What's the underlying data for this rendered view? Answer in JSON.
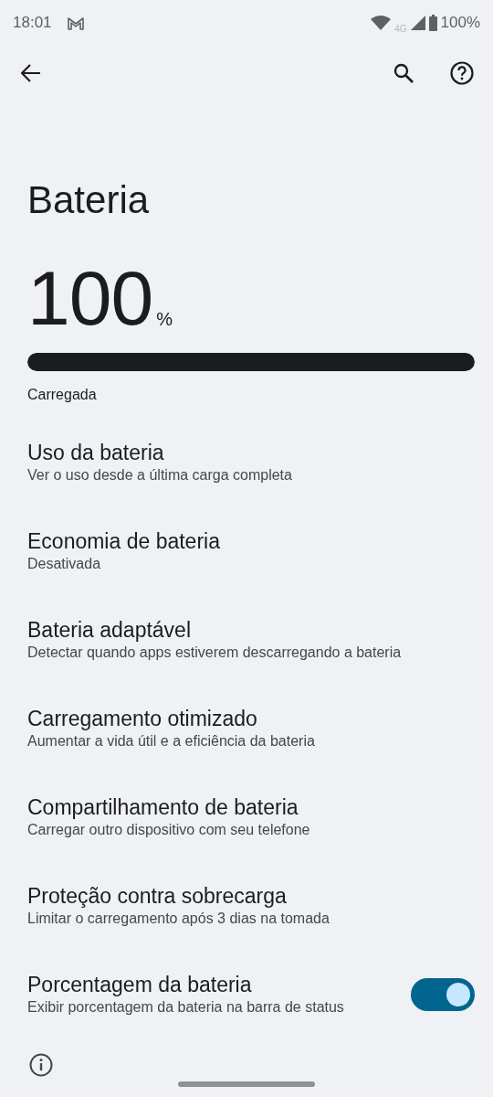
{
  "status_bar": {
    "time": "18:01",
    "network": "4G",
    "battery_text": "100%"
  },
  "title": "Bateria",
  "battery": {
    "value": "100",
    "unit": "%",
    "level": 1.0,
    "state": "Carregada"
  },
  "items": [
    {
      "kind": "link",
      "title": "Uso da bateria",
      "subtitle": "Ver o uso desde a última carga completa"
    },
    {
      "kind": "link",
      "title": "Economia de bateria",
      "subtitle": "Desativada"
    },
    {
      "kind": "link",
      "title": "Bateria adaptável",
      "subtitle": "Detectar quando apps estiverem descarregando a bateria"
    },
    {
      "kind": "link",
      "title": "Carregamento otimizado",
      "subtitle": "Aumentar a vida útil e a eficiência da bateria"
    },
    {
      "kind": "link",
      "title": "Compartilhamento de bateria",
      "subtitle": "Carregar outro dispositivo com seu telefone"
    },
    {
      "kind": "link",
      "title": "Proteção contra sobrecarga",
      "subtitle": "Limitar o carregamento após 3 dias na tomada"
    },
    {
      "kind": "switch",
      "title": "Porcentagem da bateria",
      "subtitle": "Exibir porcentagem da bateria na barra de status",
      "on": true
    }
  ]
}
